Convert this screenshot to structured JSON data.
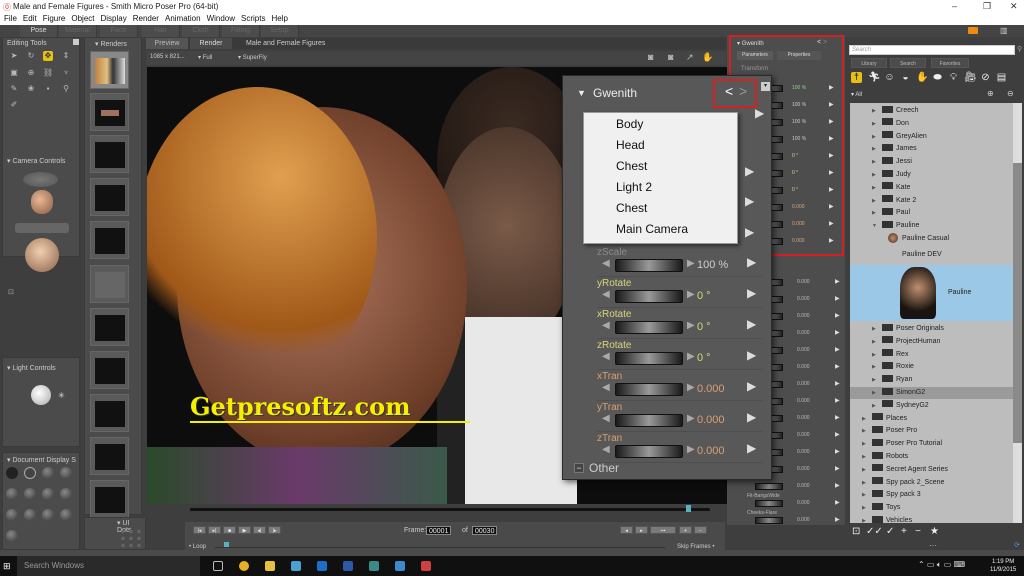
{
  "window": {
    "title": "Male and Female Figures - Smith Micro Poser Pro  (64-bit)",
    "controls": [
      "–",
      "❐",
      "✕"
    ]
  },
  "menu": [
    "File",
    "Edit",
    "Figure",
    "Object",
    "Display",
    "Render",
    "Animation",
    "Window",
    "Scripts",
    "Help"
  ],
  "room_tabs": [
    {
      "label": "Pose",
      "active": true
    },
    {
      "label": "Material",
      "active": false
    },
    {
      "label": "Face",
      "active": false
    },
    {
      "label": "Hair",
      "active": false
    },
    {
      "label": "Cloth",
      "active": false
    },
    {
      "label": "Fitting",
      "active": false
    },
    {
      "label": "Setup",
      "active": false
    }
  ],
  "editing_tools": {
    "title": "Editing Tools",
    "tools": [
      "select-icon",
      "rotate-icon",
      "translate-icon",
      "translate-in-out-icon",
      "scale-icon",
      "taper-icon",
      "chain-break-icon",
      "twist-icon",
      "color-icon",
      "grouping-icon",
      "view-magnifier-icon",
      "zoom-icon",
      "morphing-tool-icon"
    ]
  },
  "renders_panel": {
    "title": "Renders"
  },
  "camera_controls": {
    "title": "Camera Controls"
  },
  "light_controls": {
    "title": "Light Controls"
  },
  "document_display": {
    "title": "Document Display S"
  },
  "ui_dots": {
    "title": "UI Dots"
  },
  "document": {
    "tabs": [
      {
        "label": "Preview",
        "active": false
      },
      {
        "label": "Render",
        "active": true
      }
    ],
    "title": "Male and Female Figures",
    "resolution": "1085 x 821...",
    "render_size": "Full",
    "render_engine": "SuperFly"
  },
  "watermark": "Getpresoftz.com",
  "parameters_panel": {
    "figure": "Gwenith",
    "tabs": [
      "Parameters",
      "Properties"
    ],
    "group": "Transform",
    "rows": [
      {
        "value": "100 %",
        "color": "#8fd38f"
      },
      {
        "value": "100 %",
        "color": "#cccccc"
      },
      {
        "value": "100 %",
        "color": "#cccccc"
      },
      {
        "value": "100 %",
        "color": "#cccccc"
      },
      {
        "value": "0 °",
        "color": "#d8d890"
      },
      {
        "value": "0 °",
        "color": "#d8d890"
      },
      {
        "value": "0 °",
        "color": "#d8d890"
      },
      {
        "value": "0.000",
        "color": "#d8a880"
      },
      {
        "value": "0.000",
        "color": "#d8a880"
      },
      {
        "value": "0.000",
        "color": "#d8a880"
      }
    ],
    "morph_rows": [
      {
        "label": "",
        "value": "0.000"
      },
      {
        "label": "",
        "value": "0.000"
      },
      {
        "label": "",
        "value": "0.000"
      },
      {
        "label": "",
        "value": "0.000"
      },
      {
        "label": "",
        "value": "0.000"
      },
      {
        "label": "",
        "value": "0.000"
      },
      {
        "label": "",
        "value": "0.000"
      },
      {
        "label": "",
        "value": "0.000"
      },
      {
        "label": "",
        "value": "0.000"
      },
      {
        "label": "",
        "value": "0.000"
      },
      {
        "label": "",
        "value": "0.000"
      },
      {
        "label": "",
        "value": "0.000"
      },
      {
        "label": "",
        "value": "0.000"
      },
      {
        "label": "Fit-BangsWide",
        "value": "0.000"
      },
      {
        "label": "Cheeks-Flare",
        "value": "0.000"
      }
    ]
  },
  "floating_panel": {
    "title": "Gwenith",
    "prev": "<",
    "next": ">",
    "dropdown": [
      "Body",
      "Head",
      "Chest",
      "Light 2",
      "Chest",
      "Main Camera"
    ],
    "params": [
      {
        "label": "zScale",
        "value": "100 %",
        "label_color": "#8a8a8a",
        "value_color": "#cccccc"
      },
      {
        "label": "yRotate",
        "value": "0 °",
        "label_color": "#d6d67a",
        "value_color": "#d6d67a"
      },
      {
        "label": "xRotate",
        "value": "0 °",
        "label_color": "#d6d67a",
        "value_color": "#d6d67a"
      },
      {
        "label": "zRotate",
        "value": "0 °",
        "label_color": "#d6d67a",
        "value_color": "#d6d67a"
      },
      {
        "label": "xTran",
        "value": "0.000",
        "label_color": "#d8a070",
        "value_color": "#d8a070"
      },
      {
        "label": "yTran",
        "value": "0.000",
        "label_color": "#d8a070",
        "value_color": "#d8a070"
      },
      {
        "label": "zTran",
        "value": "0.000",
        "label_color": "#d8a070",
        "value_color": "#d8a070"
      }
    ],
    "other_group": "Other"
  },
  "library": {
    "search_placeholder": "Search",
    "tabs": [
      "Library",
      "Search",
      "Favorites"
    ],
    "categories": [
      "figures-icon",
      "poses-icon",
      "expressions-icon",
      "hair-icon",
      "hands-icon",
      "props-icon",
      "lights-icon",
      "cameras-icon",
      "materials-icon",
      "scenes-icon"
    ],
    "filter": "All",
    "items": [
      {
        "label": "Creech",
        "indent": 2,
        "type": "folder",
        "expanded": false
      },
      {
        "label": "Don",
        "indent": 2,
        "type": "folder",
        "expanded": false
      },
      {
        "label": "GreyAlien",
        "indent": 2,
        "type": "folder",
        "expanded": false
      },
      {
        "label": "James",
        "indent": 2,
        "type": "folder",
        "expanded": false
      },
      {
        "label": "Jessi",
        "indent": 2,
        "type": "folder",
        "expanded": false
      },
      {
        "label": "Judy",
        "indent": 2,
        "type": "folder",
        "expanded": false
      },
      {
        "label": "Kate",
        "indent": 2,
        "type": "folder",
        "expanded": false
      },
      {
        "label": "Kate 2",
        "indent": 2,
        "type": "folder",
        "expanded": false
      },
      {
        "label": "Paul",
        "indent": 2,
        "type": "folder",
        "expanded": false
      },
      {
        "label": "Pauline",
        "indent": 2,
        "type": "folder",
        "expanded": true
      },
      {
        "label": "Pauline Casual",
        "indent": 3,
        "type": "figure"
      },
      {
        "label": "Pauline DEV",
        "indent": 3,
        "type": "figure"
      },
      {
        "label": "Pauline",
        "indent": 3,
        "type": "figure-large",
        "selected": true
      },
      {
        "label": "Poser Originals",
        "indent": 2,
        "type": "folder",
        "expanded": false
      },
      {
        "label": "ProjectHuman",
        "indent": 2,
        "type": "folder",
        "expanded": false
      },
      {
        "label": "Rex",
        "indent": 2,
        "type": "folder",
        "expanded": false
      },
      {
        "label": "Roxie",
        "indent": 2,
        "type": "folder",
        "expanded": false
      },
      {
        "label": "Ryan",
        "indent": 2,
        "type": "folder",
        "expanded": false
      },
      {
        "label": "SimonG2",
        "indent": 2,
        "type": "folder",
        "expanded": false,
        "hover": true
      },
      {
        "label": "SydneyG2",
        "indent": 2,
        "type": "folder",
        "expanded": false
      },
      {
        "label": "Places",
        "indent": 1,
        "type": "folder",
        "expanded": false
      },
      {
        "label": "Poser Pro",
        "indent": 1,
        "type": "folder",
        "expanded": false
      },
      {
        "label": "Poser Pro Tutorial",
        "indent": 1,
        "type": "folder",
        "expanded": false
      },
      {
        "label": "Robots",
        "indent": 1,
        "type": "folder",
        "expanded": false
      },
      {
        "label": "Secret Agent Series",
        "indent": 1,
        "type": "folder",
        "expanded": false
      },
      {
        "label": "Spy pack 2_Scene",
        "indent": 1,
        "type": "folder",
        "expanded": false
      },
      {
        "label": "Spy pack 3",
        "indent": 1,
        "type": "folder",
        "expanded": false
      },
      {
        "label": "Toys",
        "indent": 1,
        "type": "folder",
        "expanded": false
      },
      {
        "label": "Vehicles",
        "indent": 1,
        "type": "folder",
        "expanded": false
      }
    ],
    "bottom_actions": [
      "new-folder-icon",
      "check-all-icon",
      "check-icon",
      "add-icon",
      "remove-icon",
      "favorite-icon"
    ]
  },
  "timeline": {
    "frame_label": "Frame:",
    "current_frame": "00001",
    "of_label": "of",
    "total_frames": "00030",
    "loop_label": "Loop",
    "skip_frames_label": "Skip Frames",
    "play_controls": [
      "first-frame-icon",
      "last-frame-icon",
      "stop-icon",
      "play-icon",
      "prev-frame-icon",
      "next-frame-icon"
    ],
    "key_controls": [
      "prev-key-icon",
      "next-key-icon",
      "key-icon",
      "add-key-icon",
      "remove-key-icon"
    ]
  },
  "taskbar": {
    "search_placeholder": "Search Windows",
    "time": "1:19 PM",
    "date": "11/9/2015",
    "apps": [
      {
        "name": "task-view",
        "color": "#bbbbbb"
      },
      {
        "name": "chrome",
        "color": "#e8b020"
      },
      {
        "name": "file-explorer",
        "color": "#e8c040"
      },
      {
        "name": "network-app",
        "color": "#4aa0d0"
      },
      {
        "name": "outlook",
        "color": "#1a70c8"
      },
      {
        "name": "word",
        "color": "#2a5aa8"
      },
      {
        "name": "app-7",
        "color": "#3a8a8a"
      },
      {
        "name": "app-8",
        "color": "#3a8ad0"
      },
      {
        "name": "poser",
        "color": "#d04040"
      }
    ]
  }
}
